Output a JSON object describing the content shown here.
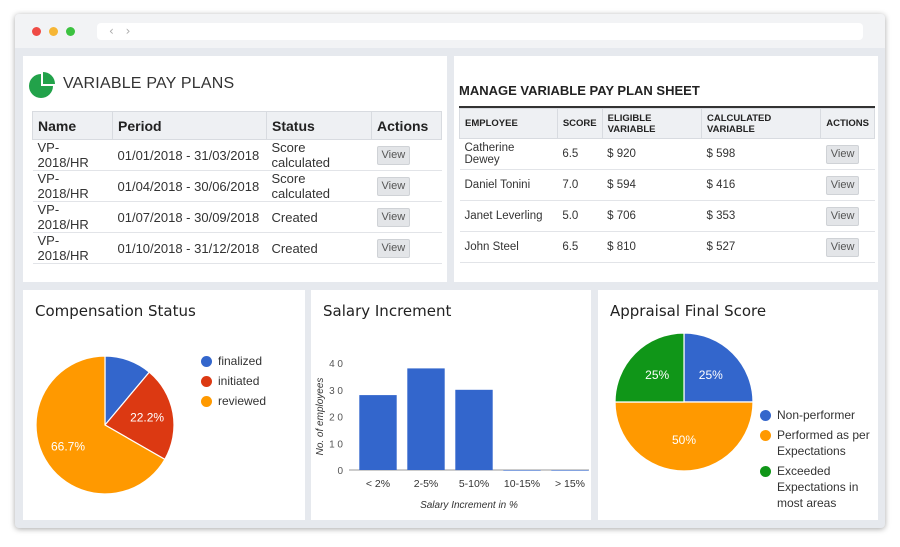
{
  "window": {
    "nav_arrows": "‹ ›"
  },
  "plans": {
    "title": "VARIABLE PAY PLANS",
    "headers": [
      "Name",
      "Period",
      "Status",
      "Actions"
    ],
    "rows": [
      {
        "name": "VP-2018/HR",
        "period": "01/01/2018 - 31/03/2018",
        "status": "Score calculated",
        "action": "View"
      },
      {
        "name": "VP-2018/HR",
        "period": "01/04/2018 - 30/06/2018",
        "status": "Score calculated",
        "action": "View"
      },
      {
        "name": "VP-2018/HR",
        "period": "01/07/2018 - 30/09/2018",
        "status": "Created",
        "action": "View"
      },
      {
        "name": "VP-2018/HR",
        "period": "01/10/2018 - 31/12/2018",
        "status": "Created",
        "action": "View"
      }
    ]
  },
  "sheet": {
    "title": "MANAGE VARIABLE PAY PLAN SHEET",
    "headers": [
      "EMPLOYEE",
      "SCORE",
      "ELIGIBLE VARIABLE",
      "CALCULATED VARIABLE",
      "ACTIONS"
    ],
    "rows": [
      {
        "employee": "Catherine Dewey",
        "score": "6.5",
        "eligible": "$ 920",
        "calculated": "$ 598",
        "action": "View"
      },
      {
        "employee": "Daniel Tonini",
        "score": "7.0",
        "eligible": "$ 594",
        "calculated": "$ 416",
        "action": "View"
      },
      {
        "employee": "Janet Leverling",
        "score": "5.0",
        "eligible": "$ 706",
        "calculated": "$ 353",
        "action": "View"
      },
      {
        "employee": "John Steel",
        "score": "6.5",
        "eligible": "$ 810",
        "calculated": "$ 527",
        "action": "View"
      }
    ]
  },
  "colors": {
    "blue": "#3366cc",
    "red": "#dc3912",
    "orange": "#ff9900",
    "green": "#109618",
    "plans_icon": "#22a24a"
  },
  "chart_data": [
    {
      "type": "pie",
      "title": "Compensation Status",
      "legend_position": "right",
      "labels": [
        "finalized",
        "initiated",
        "reviewed"
      ],
      "values": [
        11.1,
        22.2,
        66.7
      ],
      "slice_labels": [
        "",
        "22.2%",
        "66.7%"
      ],
      "colors": [
        "#3366cc",
        "#dc3912",
        "#ff9900"
      ]
    },
    {
      "type": "bar",
      "title": "Salary Increment",
      "categories": [
        "< 2%",
        "2-5%",
        "5-10%",
        "10-15%",
        "> 15%"
      ],
      "values": [
        28,
        38,
        30,
        0,
        0
      ],
      "xlabel": "Salary Increment in %",
      "ylabel": "No. of employees",
      "ylim": [
        0,
        40
      ],
      "yticks": [
        "0",
        "1 0",
        "2 0",
        "3 0",
        "4 0"
      ],
      "color": "#3366cc"
    },
    {
      "type": "pie",
      "title": "Appraisal Final Score",
      "legend_position": "right",
      "labels": [
        "Non-performer",
        "Performed as per Expectations",
        "Exceeded Expectations in most areas"
      ],
      "values": [
        25,
        50,
        25
      ],
      "slice_labels": [
        "25%",
        "50%",
        "25%"
      ],
      "colors": [
        "#3366cc",
        "#ff9900",
        "#109618"
      ]
    }
  ]
}
